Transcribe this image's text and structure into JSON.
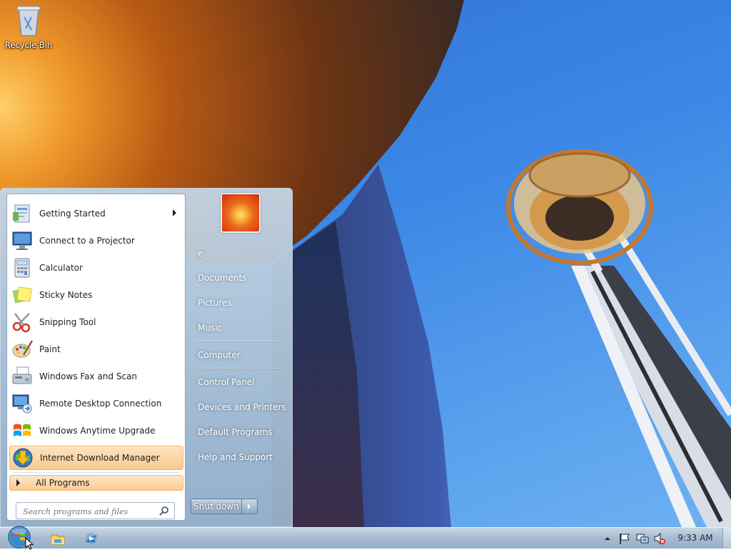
{
  "desktop": {
    "icons": [
      {
        "label": "Recycle Bin"
      }
    ]
  },
  "start_menu": {
    "programs": [
      {
        "label": "Getting Started",
        "icon": "getting-started-icon",
        "has_submenu": true
      },
      {
        "label": "Connect to a Projector",
        "icon": "projector-icon"
      },
      {
        "label": "Calculator",
        "icon": "calculator-icon"
      },
      {
        "label": "Sticky Notes",
        "icon": "sticky-notes-icon"
      },
      {
        "label": "Snipping Tool",
        "icon": "scissors-icon"
      },
      {
        "label": "Paint",
        "icon": "paint-palette-icon"
      },
      {
        "label": "Windows Fax and Scan",
        "icon": "fax-icon"
      },
      {
        "label": "Remote Desktop Connection",
        "icon": "remote-desktop-icon"
      },
      {
        "label": "Windows Anytime Upgrade",
        "icon": "windows-flag-icon"
      },
      {
        "label": "Internet Download Manager",
        "icon": "idm-globe-icon",
        "highlighted": true
      }
    ],
    "all_programs_label": "All Programs",
    "search_placeholder": "Search programs and files",
    "right_items": [
      {
        "label": "e"
      },
      {
        "label": "Documents"
      },
      {
        "label": "Pictures"
      },
      {
        "label": "Music"
      },
      {
        "label": "Computer"
      },
      {
        "label": "Control Panel"
      },
      {
        "label": "Devices and Printers"
      },
      {
        "label": "Default Programs"
      },
      {
        "label": "Help and Support"
      }
    ],
    "shutdown_label": "Shut down"
  },
  "taskbar": {
    "pinned": [
      {
        "icon": "file-explorer-icon"
      },
      {
        "icon": "media-player-icon"
      }
    ],
    "tray_icons": [
      "show-hidden-icons-icon",
      "action-center-flag-icon",
      "network-icon",
      "volume-muted-icon"
    ],
    "clock": "9:33 AM"
  }
}
